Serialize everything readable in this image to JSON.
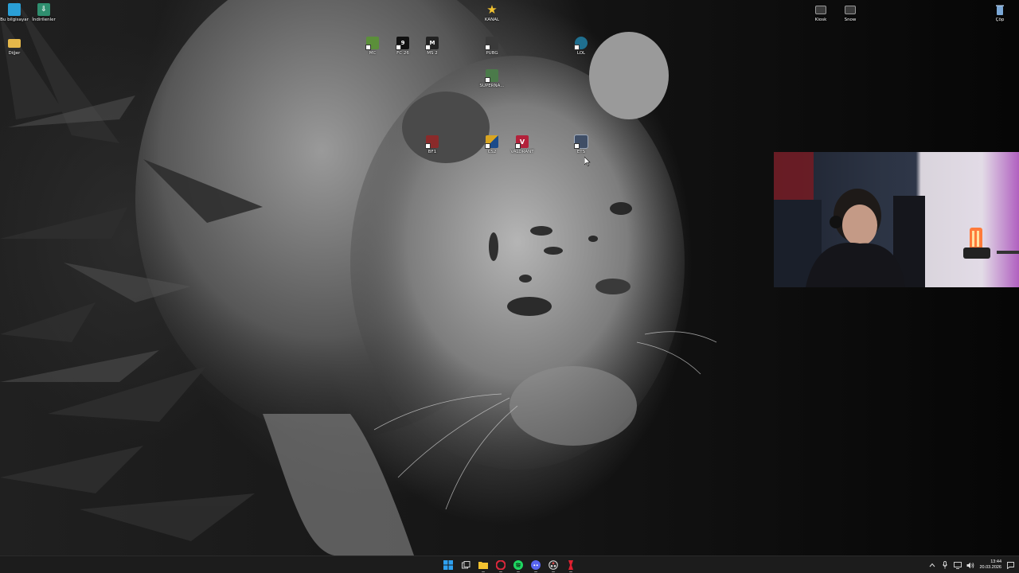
{
  "desktop": {
    "icons": [
      {
        "label": "Bu bilgisayar",
        "icon": "computer-icon",
        "color": "#2a9fd6"
      },
      {
        "label": "İndirilenler",
        "icon": "download-folder-icon",
        "color": "#2f8f6f"
      },
      {
        "label": "Diğer",
        "icon": "folder-icon",
        "color": "#e6b84a"
      },
      {
        "label": "KANAL",
        "icon": "star-icon",
        "color": "#f2c230"
      },
      {
        "label": "MC",
        "icon": "minecraft-icon",
        "color": "#5b8f3a"
      },
      {
        "label": "FC 26",
        "icon": "fc26-icon",
        "color": "#111111"
      },
      {
        "label": "MS 2",
        "icon": "ms2-icon",
        "color": "#222222"
      },
      {
        "label": "PUBG",
        "icon": "pubg-icon",
        "color": "#3a3a3a"
      },
      {
        "label": "LOL",
        "icon": "lol-icon",
        "color": "#1f6f8f"
      },
      {
        "label": "SUPERNA...",
        "icon": "supernatural-icon",
        "color": "#4b7a4a"
      },
      {
        "label": "BF1",
        "icon": "bf1-icon",
        "color": "#8a2a2a"
      },
      {
        "label": "CS2",
        "icon": "cs2-icon",
        "color": "#d9a521"
      },
      {
        "label": "VALORANT",
        "icon": "valorant-icon",
        "color": "#b3213a"
      },
      {
        "label": "ETS",
        "icon": "ets-icon",
        "color": "#3f4e66"
      },
      {
        "label": "Kiosk",
        "icon": "kiosk-icon",
        "color": "#555555"
      },
      {
        "label": "Snow",
        "icon": "snow-icon",
        "color": "#555555"
      },
      {
        "label": "Çöp",
        "icon": "recycle-bin-icon",
        "color": "#7aa7d6"
      }
    ]
  },
  "taskbar": {
    "apps": [
      {
        "name": "start-button",
        "icon": "windows-logo-icon",
        "color": "#2ea0f0"
      },
      {
        "name": "task-view-button",
        "icon": "task-view-icon",
        "color": "#d0d0d0"
      },
      {
        "name": "file-explorer-button",
        "icon": "folder-icon",
        "color": "#f2c230"
      },
      {
        "name": "opera-gx-button",
        "icon": "opera-icon",
        "color": "#e0283c"
      },
      {
        "name": "spotify-button",
        "icon": "spotify-icon",
        "color": "#1ed760"
      },
      {
        "name": "discord-button",
        "icon": "discord-icon",
        "color": "#5865f2"
      },
      {
        "name": "obs-button",
        "icon": "recording-icon",
        "color": "#e04848"
      },
      {
        "name": "app-button",
        "icon": "red-app-icon",
        "color": "#e02030"
      }
    ],
    "tray": {
      "time": "13:44",
      "date": "20.03.2026"
    }
  }
}
